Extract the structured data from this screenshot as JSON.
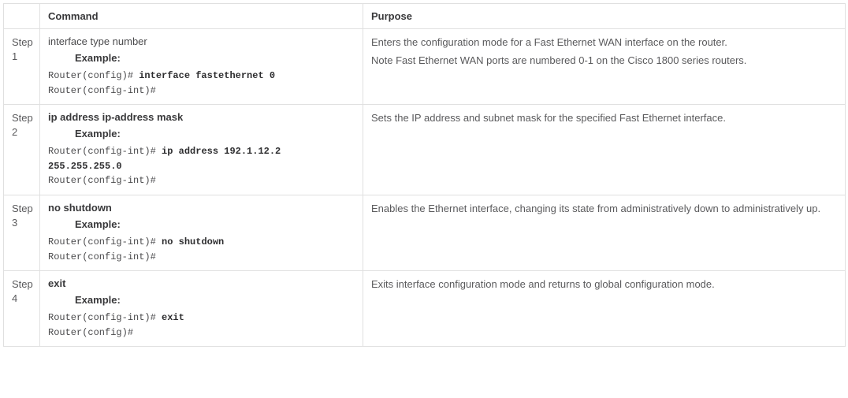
{
  "headers": {
    "blank": "",
    "command": "Command",
    "purpose": "Purpose"
  },
  "rows": [
    {
      "step": "Step 1",
      "command": {
        "text": "interface type number",
        "bold": false
      },
      "example_label": "Example:",
      "cli": [
        {
          "prompt": "Router(config)# ",
          "bold": "interface fastethernet 0"
        },
        {
          "prompt": "Router(config-int)#",
          "bold": ""
        }
      ],
      "purpose": [
        "Enters the configuration mode for a Fast Ethernet WAN interface on the router.",
        "Note Fast Ethernet WAN ports are numbered 0-1 on the Cisco 1800 series routers."
      ]
    },
    {
      "step": "Step 2",
      "command": {
        "text": "ip address ip-address mask",
        "bold": true
      },
      "example_label": "Example:",
      "cli": [
        {
          "prompt": "Router(config-int)# ",
          "bold": "ip address 192.1.12.2 255.255.255.0"
        },
        {
          "prompt": "Router(config-int)#",
          "bold": ""
        }
      ],
      "purpose": [
        "Sets the IP address and subnet mask for the specified Fast Ethernet interface."
      ]
    },
    {
      "step": "Step 3",
      "command": {
        "text": "no shutdown",
        "bold": true
      },
      "example_label": "Example:",
      "cli": [
        {
          "prompt": "Router(config-int)# ",
          "bold": "no shutdown"
        },
        {
          "prompt": "Router(config-int)#",
          "bold": ""
        }
      ],
      "purpose": [
        "Enables the Ethernet interface, changing its state from administratively down to administratively up."
      ]
    },
    {
      "step": "Step 4",
      "command": {
        "text": "exit",
        "bold": true
      },
      "example_label": "Example:",
      "cli": [
        {
          "prompt": "Router(config-int)# ",
          "bold": "exit"
        },
        {
          "prompt": "Router(config)#",
          "bold": ""
        }
      ],
      "purpose": [
        "Exits interface configuration mode and returns to global configuration mode."
      ]
    }
  ]
}
